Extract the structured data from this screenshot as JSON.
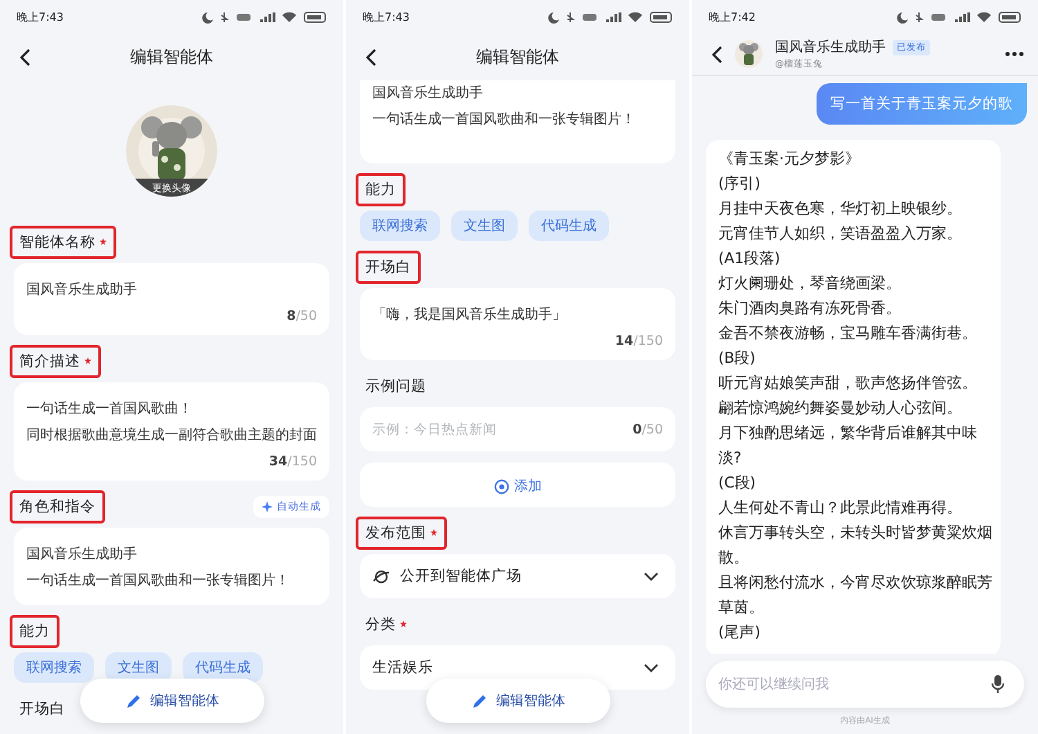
{
  "edit_screen_top": {
    "status_time": "晚上7:43",
    "title": "编辑智能体",
    "avatar_caption": "更换头像",
    "sections": [
      {
        "kind": "text",
        "label": "智能体名称",
        "required": true,
        "highlighted": true,
        "lines": [
          "国风音乐生成助手"
        ],
        "count": "8",
        "limit": "/50"
      },
      {
        "kind": "text",
        "label": "简介描述",
        "required": true,
        "highlighted": true,
        "lines": [
          "一句话生成一首国风歌曲！",
          "同时根据歌曲意境生成一副符合歌曲主题的封面"
        ],
        "count": "34",
        "limit": "/150"
      },
      {
        "kind": "text",
        "label": "角色和指令",
        "required": false,
        "highlighted": true,
        "action": "自动生成",
        "lines": [
          "国风音乐生成助手",
          "一句话生成一首国风歌曲和一张专辑图片！"
        ]
      },
      {
        "kind": "chips",
        "label": "能力",
        "required": false,
        "highlighted": true,
        "chips": [
          "联网搜索",
          "文生图",
          "代码生成"
        ]
      },
      {
        "kind": "text",
        "label": "开场白",
        "required": false,
        "highlighted": false
      }
    ],
    "floating_button": "编辑智能体"
  },
  "edit_screen_scrolled": {
    "status_time": "晚上7:43",
    "title": "编辑智能体",
    "sections": [
      {
        "kind": "text",
        "lines": [
          "国风音乐生成助手",
          "一句话生成一首国风歌曲和一张专辑图片！"
        ]
      },
      {
        "kind": "chips",
        "label": "能力",
        "required": false,
        "highlighted": true,
        "chips": [
          "联网搜索",
          "文生图",
          "代码生成"
        ]
      },
      {
        "kind": "text",
        "label": "开场白",
        "required": false,
        "highlighted": true,
        "lines": [
          "「嗨，我是国风音乐生成助手」"
        ],
        "count": "14",
        "limit": "/150"
      },
      {
        "kind": "input",
        "label": "示例问题",
        "required": false,
        "highlighted": false,
        "placeholder": "示例：今日热点新闻",
        "count": "0",
        "limit": "/50"
      },
      {
        "kind": "add",
        "button": "添加"
      },
      {
        "kind": "scope_select",
        "label": "发布范围",
        "required": true,
        "highlighted": true,
        "value": "公开到智能体广场"
      },
      {
        "kind": "select",
        "label": "分类",
        "required": true,
        "highlighted": false,
        "value": "生活娱乐"
      }
    ],
    "floating_button": "编辑智能体"
  },
  "chat_screen": {
    "status_time": "晚上7:42",
    "bot_name": "国风音乐生成助手",
    "badge": "已发布",
    "handle": "@榴莲玉兔",
    "messages": [
      {
        "kind": "user",
        "lines": [
          "写一首关于青玉案元夕的歌"
        ]
      },
      {
        "kind": "bot",
        "lines": [
          "《青玉案·元夕梦影》",
          "(序引)",
          "月挂中天夜色寒，华灯初上映银纱。",
          "元宵佳节人如织，笑语盈盈入万家。",
          "(A1段落)",
          "灯火阑珊处，琴音绕画梁。",
          "朱门酒肉臭路有冻死骨香。",
          "金吾不禁夜游畅，宝马雕车香满街巷。",
          "(B段)",
          "听元宵姑娘笑声甜，歌声悠扬伴管弦。",
          "翩若惊鸿婉约舞姿曼妙动人心弦间。",
          "月下独酌思绪远，繁华背后谁解其中味淡?",
          "(C段)",
          "人生何处不青山？此景此情难再得。",
          "休言万事转头空，未转头时皆梦黄粱炊烟散。",
          "且将闲愁付流水，今宵尽欢饮琼浆醉眠芳草茵。",
          "(尾声)"
        ]
      }
    ],
    "input_placeholder": "你还可以继续问我",
    "footer": "内容由AI生成"
  }
}
